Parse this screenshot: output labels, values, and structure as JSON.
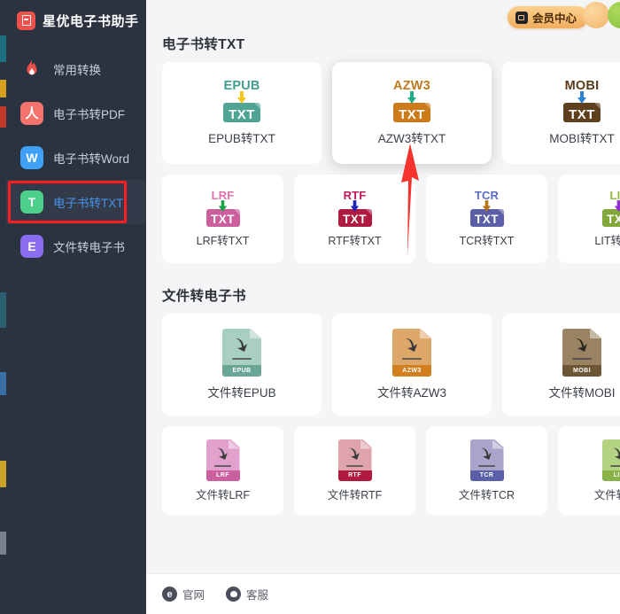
{
  "app": {
    "title": "星优电子书助手",
    "logo_icon": "book-app-logo-icon"
  },
  "sidebar": {
    "items": [
      {
        "label": "常用转换",
        "icon": "flame-icon",
        "icon_glyph": "",
        "color": "#f0524b",
        "active": false
      },
      {
        "label": "电子书转PDF",
        "icon": "pdf-icon",
        "icon_glyph": "人",
        "color": "#f4736b",
        "active": false
      },
      {
        "label": "电子书转Word",
        "icon": "word-icon",
        "icon_glyph": "W",
        "color": "#3fa0f5",
        "active": false
      },
      {
        "label": "电子书转TXT",
        "icon": "txt-icon",
        "icon_glyph": "T",
        "color": "#4cd08a",
        "active": true
      },
      {
        "label": "文件转电子书",
        "icon": "ebook-icon",
        "icon_glyph": "E",
        "color": "#8a6cf0",
        "active": false
      }
    ]
  },
  "topbar": {
    "member_button": "会员中心",
    "member_icon": "vip-badge-icon",
    "avatar_orange": "avatar-orange",
    "avatar_green": "avatar-green"
  },
  "sections": [
    {
      "title": "电子书转TXT",
      "rows": [
        {
          "size": "wide",
          "cards": [
            {
              "label": "EPUB转TXT",
              "fmt": "EPUB",
              "target": "TXT",
              "fmt_color": "#3f9e8e",
              "box_color": "#4fa496",
              "arrow_color": "#f5c518",
              "selected": false
            },
            {
              "label": "AZW3转TXT",
              "fmt": "AZW3",
              "target": "TXT",
              "fmt_color": "#c07a1e",
              "box_color": "#cc7a1a",
              "arrow_color": "#1fae86",
              "selected": true
            },
            {
              "label": "MOBI转TXT",
              "fmt": "MOBI",
              "target": "TXT",
              "fmt_color": "#5a3b1c",
              "box_color": "#5f401e",
              "arrow_color": "#2d7fd4",
              "selected": false
            }
          ]
        },
        {
          "size": "narrow",
          "cards": [
            {
              "label": "LRF转TXT",
              "fmt": "LRF",
              "target": "TXT",
              "fmt_color": "#e06fae",
              "box_color": "#cc5f9e",
              "arrow_color": "#16a34a",
              "selected": false
            },
            {
              "label": "RTF转TXT",
              "fmt": "RTF",
              "target": "TXT",
              "fmt_color": "#c2185b",
              "box_color": "#b01a3e",
              "arrow_color": "#1b23b8",
              "selected": false
            },
            {
              "label": "TCR转TXT",
              "fmt": "TCR",
              "target": "TXT",
              "fmt_color": "#5b6bbf",
              "box_color": "#5a5fa8",
              "arrow_color": "#b5761a",
              "selected": false
            },
            {
              "label": "LIT转TXT",
              "fmt": "LIT",
              "target": "TXT",
              "fmt_color": "#8fbe3f",
              "box_color": "#82a83c",
              "arrow_color": "#8e2fd0",
              "selected": false
            }
          ]
        }
      ]
    },
    {
      "title": "文件转电子书",
      "rows": [
        {
          "size": "wide",
          "cards": [
            {
              "label": "文件转EPUB",
              "band": "EPUB",
              "page_color": "#a8cfc2",
              "band_color": "#6aa695",
              "selected": false
            },
            {
              "label": "文件转AZW3",
              "band": "AZW3",
              "page_color": "#dda76a",
              "band_color": "#d2801f",
              "selected": false
            },
            {
              "label": "文件转MOBI",
              "band": "MOBI",
              "page_color": "#9a8362",
              "band_color": "#6d5634",
              "selected": false
            }
          ]
        },
        {
          "size": "narrow",
          "cards": [
            {
              "label": "文件转LRF",
              "band": "LRF",
              "page_color": "#e2a0cd",
              "band_color": "#cc5f9e",
              "selected": false
            },
            {
              "label": "文件转RTF",
              "band": "RTF",
              "page_color": "#dea3ab",
              "band_color": "#b01a3e",
              "selected": false
            },
            {
              "label": "文件转TCR",
              "band": "TCR",
              "page_color": "#a9a4c9",
              "band_color": "#5a5fa8",
              "selected": false
            },
            {
              "label": "文件转LIT",
              "band": "LIT",
              "page_color": "#b5d483",
              "band_color": "#8bb24a",
              "selected": false
            }
          ]
        }
      ]
    }
  ],
  "footer": {
    "links": [
      {
        "label": "官网",
        "icon": "edge-browser-icon"
      },
      {
        "label": "客服",
        "icon": "chat-support-icon"
      }
    ]
  },
  "annotations": {
    "highlight_color": "#ff1e1e",
    "arrow_target": "AZW3转TXT",
    "highlight_target": "电子书转TXT"
  }
}
